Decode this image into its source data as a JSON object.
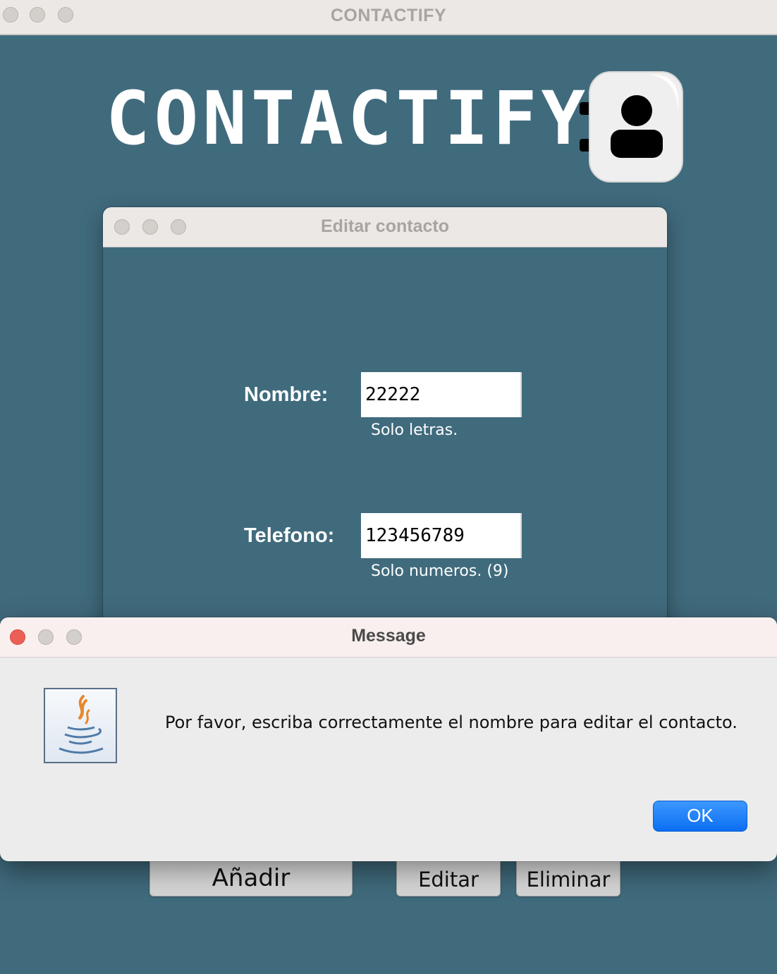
{
  "main_window": {
    "title": "CONTACTIFY"
  },
  "brand": {
    "title": "CONTACTIFY",
    "logo_icon": "contact-book-icon"
  },
  "edit_dialog": {
    "title": "Editar contacto",
    "fields": [
      {
        "label": "Nombre:",
        "value": "22222",
        "hint": "Solo letras."
      },
      {
        "label": "Telefono:",
        "value": "123456789",
        "hint": "Solo numeros. (9)"
      }
    ]
  },
  "actions": {
    "add": "Añadir",
    "edit": "Editar",
    "delete": "Eliminar"
  },
  "message_dialog": {
    "title": "Message",
    "icon": "java-icon",
    "text": "Por favor, escriba correctamente el nombre para editar el contacto.",
    "ok_label": "OK"
  },
  "colors": {
    "background": "#406b7d",
    "titlebar": "#ece8e5",
    "ok_button": "#0b6ff2",
    "close_red": "#ec5f57"
  }
}
